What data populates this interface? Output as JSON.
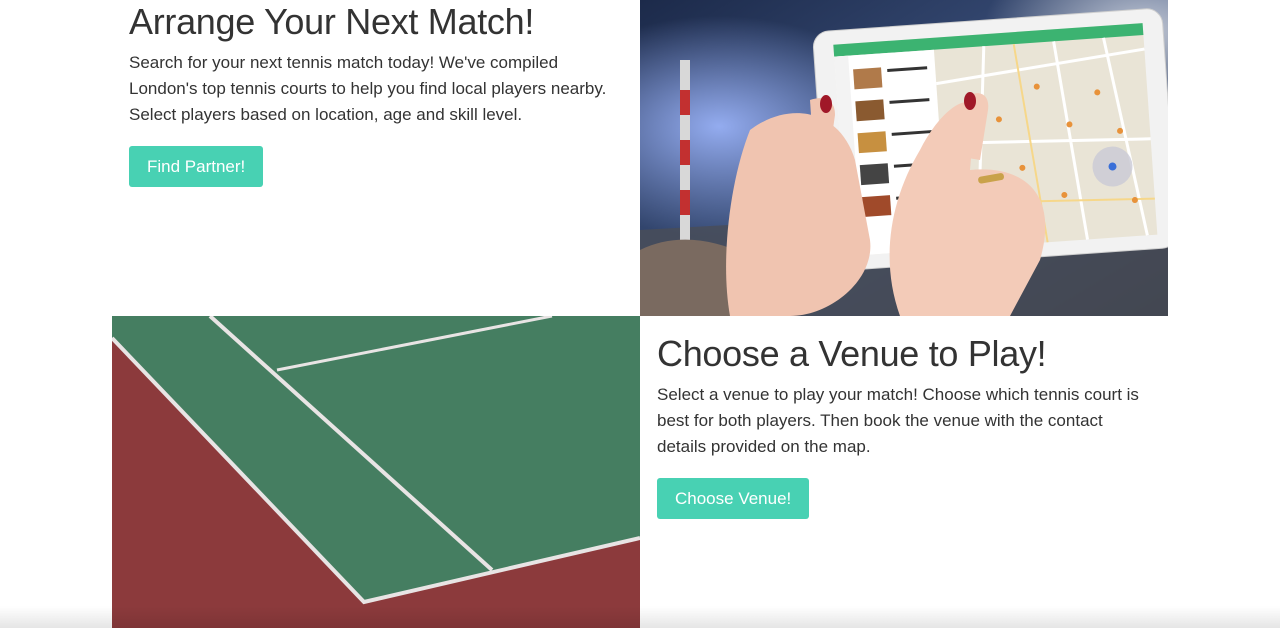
{
  "section_arrange": {
    "title": "Arrange Your Next Match!",
    "description": "Search for your next tennis match today! We've compiled London's top tennis courts to help you find local players nearby. Select players based on location, age and skill level.",
    "button_label": "Find Partner!",
    "image": "tablet-map-photo"
  },
  "section_venue": {
    "title": "Choose a Venue to Play!",
    "description": "Select a venue to play your match! Choose which tennis court is best for both players. Then book the venue with the contact details provided on the map.",
    "button_label": "Choose Venue!",
    "image": "tennis-court-photo"
  },
  "colors": {
    "accent": "#48d1b3",
    "text": "#333333",
    "court_green": "#3f7a5c",
    "court_red": "#8c3a3c"
  }
}
